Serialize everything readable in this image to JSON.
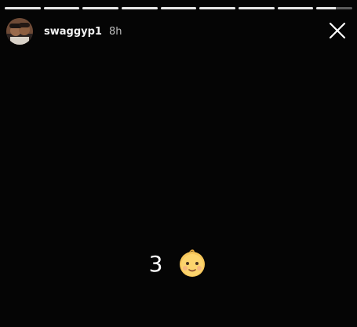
{
  "story": {
    "segments": [
      {
        "progress": 1
      },
      {
        "progress": 1
      },
      {
        "progress": 1
      },
      {
        "progress": 1
      },
      {
        "progress": 1
      },
      {
        "progress": 1
      },
      {
        "progress": 1
      },
      {
        "progress": 1
      },
      {
        "progress": 0.55
      }
    ],
    "header": {
      "username": "swaggyp1",
      "time": "8h",
      "avatar_icon": "profile-photo",
      "close_icon": "close-x-icon"
    },
    "caption": {
      "number": "3",
      "emoji_icon": "baby-face-emoji"
    }
  }
}
